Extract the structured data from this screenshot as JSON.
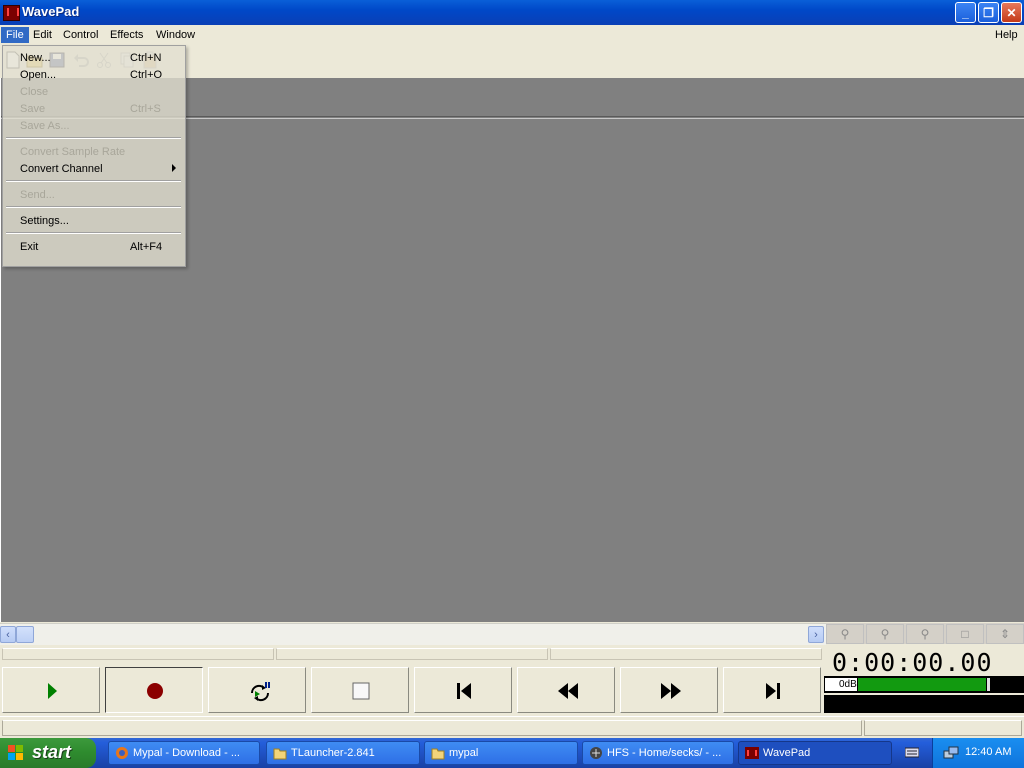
{
  "window": {
    "title": "WavePad",
    "controls": {
      "minimize": "_",
      "restore": "❐",
      "close": "✕"
    }
  },
  "menubar": {
    "items": [
      "File",
      "Edit",
      "Control",
      "Effects",
      "Window"
    ],
    "help": "Help",
    "active": "File"
  },
  "file_menu": {
    "items": [
      {
        "label": "New...",
        "shortcut": "Ctrl+N",
        "enabled": true
      },
      {
        "label": "Open...",
        "shortcut": "Ctrl+O",
        "enabled": true
      },
      {
        "label": "Close",
        "shortcut": "",
        "enabled": false
      },
      {
        "label": "Save",
        "shortcut": "Ctrl+S",
        "enabled": false
      },
      {
        "label": "Save As...",
        "shortcut": "",
        "enabled": false
      },
      {
        "label": "Convert Sample Rate",
        "shortcut": "",
        "enabled": false
      },
      {
        "label": "Convert Channel",
        "shortcut": "",
        "enabled": true,
        "submenu": true
      },
      {
        "label": "Send...",
        "shortcut": "",
        "enabled": false
      },
      {
        "label": "Settings...",
        "shortcut": "",
        "enabled": true
      },
      {
        "label": "Exit",
        "shortcut": "Alt+F4",
        "enabled": true
      }
    ]
  },
  "toolbar": {
    "icons": [
      "new-file-icon",
      "open-folder-icon",
      "save-icon",
      "undo-icon",
      "cut-icon",
      "copy-icon",
      "paste-icon"
    ]
  },
  "zoom_buttons": [
    "zoom-in-icon",
    "zoom-out-icon",
    "zoom-selection-icon",
    "zoom-full-icon",
    "zoom-vertical-icon"
  ],
  "transport": {
    "buttons": [
      "play",
      "record",
      "loop-play",
      "stop",
      "go-to-start",
      "rewind",
      "fast-forward",
      "go-to-end"
    ]
  },
  "time_display": {
    "time": "0:00:00.00",
    "meter_label": "0dB",
    "level_fraction": 0.79
  },
  "colors": {
    "title_bar": "#0048c8",
    "workspace": "#808080",
    "play_icon": "#008000",
    "record_icon": "#8b0000",
    "meter_level": "#129a10"
  },
  "taskbar": {
    "start_label": "start",
    "tasks": [
      {
        "label": "Mypal - Download - ...",
        "icon": "mypal-browser-icon",
        "active": false
      },
      {
        "label": "TLauncher-2.841",
        "icon": "folder-icon",
        "active": false
      },
      {
        "label": "mypal",
        "icon": "folder-icon",
        "active": false
      },
      {
        "label": "HFS - Home/secks/ - ...",
        "icon": "hfs-server-icon",
        "active": false
      },
      {
        "label": "WavePad",
        "icon": "wavepad-icon",
        "active": true
      }
    ],
    "clock": "12:40 AM"
  }
}
